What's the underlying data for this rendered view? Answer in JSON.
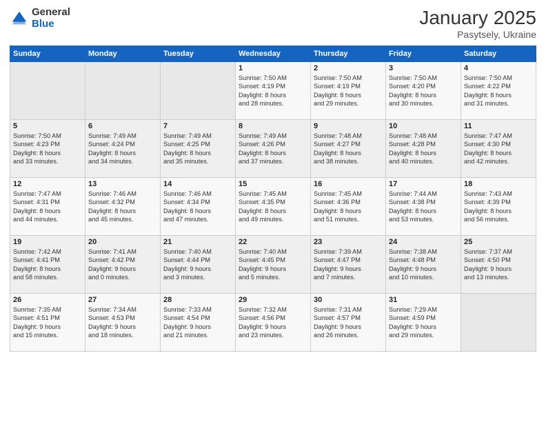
{
  "logo": {
    "general": "General",
    "blue": "Blue"
  },
  "header": {
    "month": "January 2025",
    "location": "Pasytsely, Ukraine"
  },
  "weekdays": [
    "Sunday",
    "Monday",
    "Tuesday",
    "Wednesday",
    "Thursday",
    "Friday",
    "Saturday"
  ],
  "weeks": [
    [
      {
        "day": "",
        "info": ""
      },
      {
        "day": "",
        "info": ""
      },
      {
        "day": "",
        "info": ""
      },
      {
        "day": "1",
        "info": "Sunrise: 7:50 AM\nSunset: 4:19 PM\nDaylight: 8 hours\nand 28 minutes."
      },
      {
        "day": "2",
        "info": "Sunrise: 7:50 AM\nSunset: 4:19 PM\nDaylight: 8 hours\nand 29 minutes."
      },
      {
        "day": "3",
        "info": "Sunrise: 7:50 AM\nSunset: 4:20 PM\nDaylight: 8 hours\nand 30 minutes."
      },
      {
        "day": "4",
        "info": "Sunrise: 7:50 AM\nSunset: 4:22 PM\nDaylight: 8 hours\nand 31 minutes."
      }
    ],
    [
      {
        "day": "5",
        "info": "Sunrise: 7:50 AM\nSunset: 4:23 PM\nDaylight: 8 hours\nand 33 minutes."
      },
      {
        "day": "6",
        "info": "Sunrise: 7:49 AM\nSunset: 4:24 PM\nDaylight: 8 hours\nand 34 minutes."
      },
      {
        "day": "7",
        "info": "Sunrise: 7:49 AM\nSunset: 4:25 PM\nDaylight: 8 hours\nand 35 minutes."
      },
      {
        "day": "8",
        "info": "Sunrise: 7:49 AM\nSunset: 4:26 PM\nDaylight: 8 hours\nand 37 minutes."
      },
      {
        "day": "9",
        "info": "Sunrise: 7:48 AM\nSunset: 4:27 PM\nDaylight: 8 hours\nand 38 minutes."
      },
      {
        "day": "10",
        "info": "Sunrise: 7:48 AM\nSunset: 4:28 PM\nDaylight: 8 hours\nand 40 minutes."
      },
      {
        "day": "11",
        "info": "Sunrise: 7:47 AM\nSunset: 4:30 PM\nDaylight: 8 hours\nand 42 minutes."
      }
    ],
    [
      {
        "day": "12",
        "info": "Sunrise: 7:47 AM\nSunset: 4:31 PM\nDaylight: 8 hours\nand 44 minutes."
      },
      {
        "day": "13",
        "info": "Sunrise: 7:46 AM\nSunset: 4:32 PM\nDaylight: 8 hours\nand 45 minutes."
      },
      {
        "day": "14",
        "info": "Sunrise: 7:46 AM\nSunset: 4:34 PM\nDaylight: 8 hours\nand 47 minutes."
      },
      {
        "day": "15",
        "info": "Sunrise: 7:45 AM\nSunset: 4:35 PM\nDaylight: 8 hours\nand 49 minutes."
      },
      {
        "day": "16",
        "info": "Sunrise: 7:45 AM\nSunset: 4:36 PM\nDaylight: 8 hours\nand 51 minutes."
      },
      {
        "day": "17",
        "info": "Sunrise: 7:44 AM\nSunset: 4:38 PM\nDaylight: 8 hours\nand 53 minutes."
      },
      {
        "day": "18",
        "info": "Sunrise: 7:43 AM\nSunset: 4:39 PM\nDaylight: 8 hours\nand 56 minutes."
      }
    ],
    [
      {
        "day": "19",
        "info": "Sunrise: 7:42 AM\nSunset: 4:41 PM\nDaylight: 8 hours\nand 58 minutes."
      },
      {
        "day": "20",
        "info": "Sunrise: 7:41 AM\nSunset: 4:42 PM\nDaylight: 9 hours\nand 0 minutes."
      },
      {
        "day": "21",
        "info": "Sunrise: 7:40 AM\nSunset: 4:44 PM\nDaylight: 9 hours\nand 3 minutes."
      },
      {
        "day": "22",
        "info": "Sunrise: 7:40 AM\nSunset: 4:45 PM\nDaylight: 9 hours\nand 5 minutes."
      },
      {
        "day": "23",
        "info": "Sunrise: 7:39 AM\nSunset: 4:47 PM\nDaylight: 9 hours\nand 7 minutes."
      },
      {
        "day": "24",
        "info": "Sunrise: 7:38 AM\nSunset: 4:48 PM\nDaylight: 9 hours\nand 10 minutes."
      },
      {
        "day": "25",
        "info": "Sunrise: 7:37 AM\nSunset: 4:50 PM\nDaylight: 9 hours\nand 13 minutes."
      }
    ],
    [
      {
        "day": "26",
        "info": "Sunrise: 7:35 AM\nSunset: 4:51 PM\nDaylight: 9 hours\nand 15 minutes."
      },
      {
        "day": "27",
        "info": "Sunrise: 7:34 AM\nSunset: 4:53 PM\nDaylight: 9 hours\nand 18 minutes."
      },
      {
        "day": "28",
        "info": "Sunrise: 7:33 AM\nSunset: 4:54 PM\nDaylight: 9 hours\nand 21 minutes."
      },
      {
        "day": "29",
        "info": "Sunrise: 7:32 AM\nSunset: 4:56 PM\nDaylight: 9 hours\nand 23 minutes."
      },
      {
        "day": "30",
        "info": "Sunrise: 7:31 AM\nSunset: 4:57 PM\nDaylight: 9 hours\nand 26 minutes."
      },
      {
        "day": "31",
        "info": "Sunrise: 7:29 AM\nSunset: 4:59 PM\nDaylight: 9 hours\nand 29 minutes."
      },
      {
        "day": "",
        "info": ""
      }
    ]
  ]
}
